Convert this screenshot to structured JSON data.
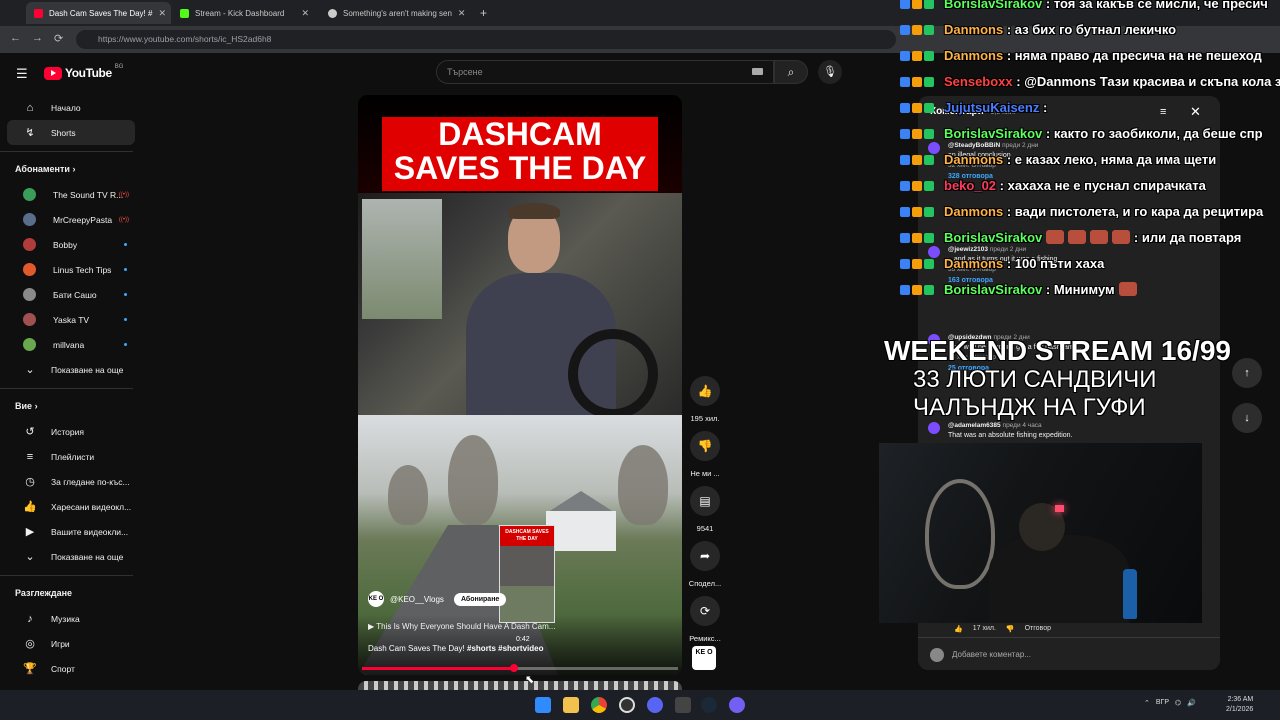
{
  "browser": {
    "tabs": [
      {
        "title": "Dash Cam Saves The Day! #",
        "fav_color": "#ff0033",
        "active": true
      },
      {
        "title": "Stream - Kick Dashboard",
        "fav_color": "#53fc18",
        "active": false
      },
      {
        "title": "Something's aren't making sen",
        "fav_color": "#cccccc",
        "active": false
      }
    ],
    "new_tab": "+",
    "url": "https://www.youtube.com/shorts/ic_HS2ad6h8"
  },
  "youtube": {
    "logo_text": "YouTube",
    "region": "BG",
    "search_placeholder": "Търсене",
    "create_label": "Създаване"
  },
  "sidebar": {
    "main": [
      {
        "label": "Начало",
        "icon": "home-icon",
        "glyph": "⌂",
        "active": false
      },
      {
        "label": "Shorts",
        "icon": "shorts-icon",
        "glyph": "↯",
        "active": true
      }
    ],
    "subscriptions_header": "Абонаменти",
    "subscriptions": [
      {
        "label": "The Sound TV R...",
        "color": "#3a9e5a",
        "status": "live"
      },
      {
        "label": "MrCreepyPasta",
        "color": "#5a6e8c",
        "status": "live"
      },
      {
        "label": "Bobby",
        "color": "#b23b3b",
        "status": "dot"
      },
      {
        "label": "Linus Tech Tips",
        "color": "#e05a2b",
        "status": "dot"
      },
      {
        "label": "Бати Сашо",
        "color": "#8a8a8a",
        "status": "dot"
      },
      {
        "label": "Yaska TV",
        "color": "#a05050",
        "status": "dot"
      },
      {
        "label": "millvana",
        "color": "#6aa84f",
        "status": "dot"
      }
    ],
    "show_more": "Показване на още",
    "you_header": "Вие",
    "you": [
      {
        "label": "История",
        "icon": "history-icon",
        "glyph": "↺"
      },
      {
        "label": "Плейлисти",
        "icon": "playlists-icon",
        "glyph": "≡"
      },
      {
        "label": "За гледане по-къс...",
        "icon": "watch-later-icon",
        "glyph": "◷"
      },
      {
        "label": "Харесани видеокл...",
        "icon": "liked-icon",
        "glyph": "👍"
      },
      {
        "label": "Вашите видеокли...",
        "icon": "your-videos-icon",
        "glyph": "▶"
      },
      {
        "label": "Показване на още",
        "icon": "chevron-down-icon",
        "glyph": "⌄"
      }
    ],
    "explore_header": "Разглеждане",
    "explore": [
      {
        "label": "Музика",
        "icon": "music-icon",
        "glyph": "♪"
      },
      {
        "label": "Игри",
        "icon": "games-icon",
        "glyph": "◎"
      },
      {
        "label": "Спорт",
        "icon": "sport-icon",
        "glyph": "🏆"
      }
    ]
  },
  "short": {
    "title_line1": "DASHCAM",
    "title_line2": "SAVES THE DAY",
    "channel": "@KEO__Vlogs",
    "channel_avatar": "KE O",
    "subscribe": "Абониране",
    "related": "This Is Why Everyone Should Have A Dash Cam...",
    "timecode": "0:42",
    "description": "Dash Cam Saves The Day!",
    "tags": "#shorts #shortvideo",
    "thumb_text": "DASHCAM SAVES THE DAY",
    "progress": 0.48
  },
  "actions": [
    {
      "name": "like-button",
      "icon": "thumbs-up-icon",
      "glyph": "👍",
      "label": "195 хил."
    },
    {
      "name": "dislike-button",
      "icon": "thumbs-down-icon",
      "glyph": "👎",
      "label": "Не ми ..."
    },
    {
      "name": "comments-button",
      "icon": "comment-icon",
      "glyph": "▤",
      "label": "9541"
    },
    {
      "name": "share-button",
      "icon": "share-icon",
      "glyph": "➦",
      "label": "Сподел..."
    },
    {
      "name": "remix-button",
      "icon": "remix-icon",
      "glyph": "⟳",
      "label": "Ремикс..."
    }
  ],
  "comments": {
    "header": "Коментари",
    "count": "9,5 хил.",
    "items": [
      {
        "author": "@SteadyBoBBiN",
        "time": "преди 2 дни",
        "text": "an illegal conclusion",
        "likes": "52 хил.",
        "reply": "Отговор",
        "replies": "328 отговора"
      },
      {
        "author": "@jeewiz2103",
        "time": "преди 2 дни",
        "text": "...and as it turns out it was a fishing.",
        "likes": "35 хил.",
        "reply": "Отговор",
        "replies": "163 отговора"
      },
      {
        "author": "@upsidezdwn",
        "time": "преди 2 дни",
        "text": "...no way he is gonna get a fair dashcam ...",
        "likes": "13 хил.",
        "reply": "Отговор",
        "replies": "25 отговора"
      },
      {
        "author": "@adamelam6385",
        "time": "преди 4 часа",
        "text": "That was an absolute fishing expedition.",
        "likes": "17 хил.",
        "reply": "Отговор",
        "replies": ""
      }
    ],
    "add_placeholder": "Добавете коментар..."
  },
  "chat": [
    {
      "user": "BorislavSirakov",
      "color": "#5cff5c",
      "msg": ": тоя за какъв се мисли, че пресич"
    },
    {
      "user": "Danmons",
      "color": "#ffb347",
      "msg": ": аз бих го бутнал лекичко"
    },
    {
      "user": "Danmons",
      "color": "#ffb347",
      "msg": ": няма право да пресича на не пешеход"
    },
    {
      "user": "Senseboxx",
      "color": "#ff4040",
      "msg": ": @Danmons Тази красива и скъпа кола за"
    },
    {
      "user": "JujutsuKaisenz",
      "color": "#4a7dff",
      "msg": ":"
    },
    {
      "user": "BorislavSirakov",
      "color": "#5cff5c",
      "msg": ": както го заобиколи, да беше спр"
    },
    {
      "user": "Danmons",
      "color": "#ffb347",
      "msg": ": е казах леко, няма да има щети"
    },
    {
      "user": "beko_02",
      "color": "#ff3b5c",
      "msg": ": хахаха не е пуснал спирачката"
    },
    {
      "user": "Danmons",
      "color": "#ffb347",
      "msg": ": вади пистолета, и го кара да рецитира"
    },
    {
      "user": "BorislavSirakov",
      "color": "#5cff5c",
      "msg": ": или да повтаря"
    },
    {
      "user": "Danmons",
      "color": "#ffb347",
      "msg": ": 100 пъти хаха"
    },
    {
      "user": "BorislavSirakov",
      "color": "#5cff5c",
      "msg": ": Минимум"
    }
  ],
  "overlay": {
    "line1": "WEEKEND STREAM 16/99",
    "line2": "33 ЛЮТИ САНДВИЧИ",
    "line3": "ЧАЛЪНДЖ НА ГУФИ"
  },
  "taskbar": {
    "tray": "ВГР",
    "time": "2:36 AM",
    "date": "2/1/2026"
  }
}
